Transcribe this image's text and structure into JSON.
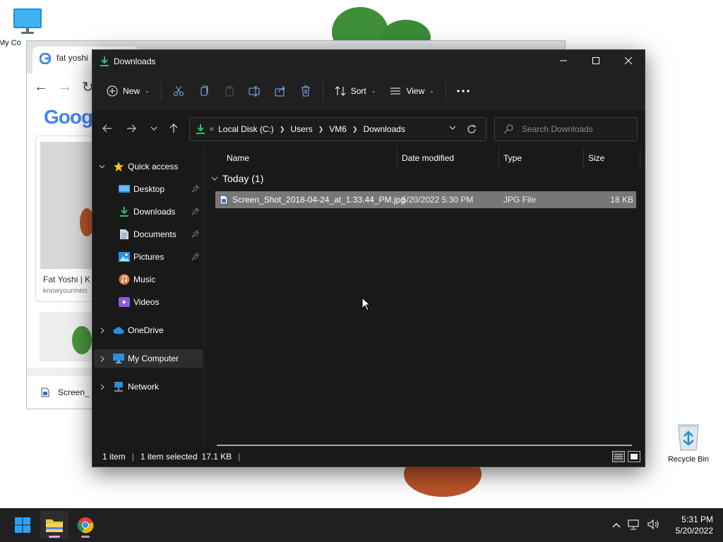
{
  "desktop": {
    "icons": [
      {
        "name": "my-computer",
        "label": "My Co"
      },
      {
        "name": "recycle-bin",
        "label": "Recycle Bin"
      }
    ]
  },
  "chrome": {
    "tab_title": "fat yoshi",
    "google_logo": "Goog",
    "card_title": "Fat Yoshi | K",
    "card_source": "knowyourmen",
    "download_item": "Screen_"
  },
  "explorer": {
    "title": "Downloads",
    "commands": {
      "new": "New",
      "sort": "Sort",
      "view": "View"
    },
    "breadcrumb": {
      "prefix": "«",
      "items": [
        "Local Disk (C:)",
        "Users",
        "VM6",
        "Downloads"
      ]
    },
    "search_placeholder": "Search Downloads",
    "nav": {
      "quick_access": "Quick access",
      "items": [
        "Desktop",
        "Downloads",
        "Documents",
        "Pictures",
        "Music",
        "Videos"
      ],
      "onedrive": "OneDrive",
      "my_computer": "My Computer",
      "network": "Network"
    },
    "columns": {
      "name": "Name",
      "date": "Date modified",
      "type": "Type",
      "size": "Size"
    },
    "group_label": "Today (1)",
    "files": [
      {
        "name": "Screen_Shot_2018-04-24_at_1.33.44_PM.jpg",
        "date": "5/20/2022 5:30 PM",
        "type": "JPG File",
        "size": "18 KB"
      }
    ],
    "status": {
      "count": "1 item",
      "selected": "1 item selected",
      "sel_size": "17.1 KB"
    }
  },
  "taskbar": {
    "time": "5:31 PM",
    "date": "5/20/2022"
  },
  "colors": {
    "explorer_bg": "#191919",
    "selection": "#777777",
    "accent_green": "#2fbf71",
    "taskbar": "#202020"
  }
}
